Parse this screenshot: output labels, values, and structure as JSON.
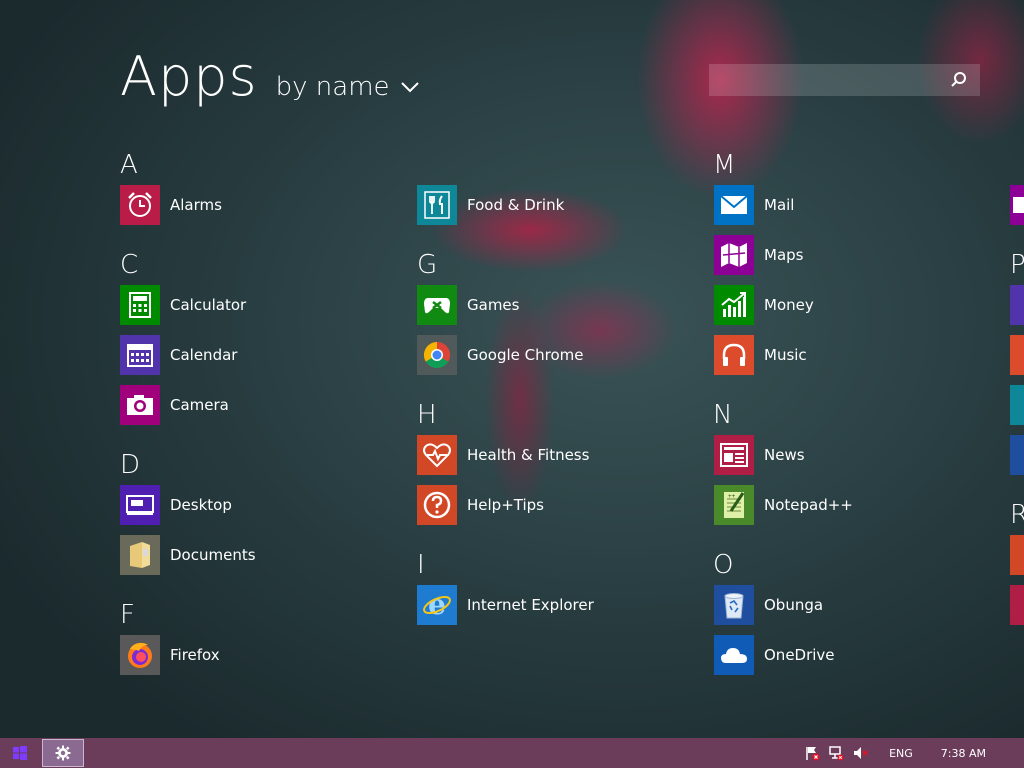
{
  "header": {
    "title": "Apps",
    "sort_label": "by name"
  },
  "search": {
    "value": "",
    "placeholder": ""
  },
  "groups": {
    "a": {
      "letter": "A"
    },
    "c": {
      "letter": "C"
    },
    "d": {
      "letter": "D"
    },
    "f": {
      "letter": "F"
    },
    "g": {
      "letter": "G"
    },
    "h": {
      "letter": "H"
    },
    "i": {
      "letter": "I"
    },
    "m": {
      "letter": "M"
    },
    "n": {
      "letter": "N"
    },
    "o": {
      "letter": "O"
    },
    "p": {
      "letter": "P"
    },
    "r": {
      "letter": "R"
    }
  },
  "apps": {
    "alarms": {
      "label": "Alarms",
      "icon": "alarm-clock-icon",
      "color": "#b91d47"
    },
    "calculator": {
      "label": "Calculator",
      "icon": "calculator-icon",
      "color": "#008a00"
    },
    "calendar": {
      "label": "Calendar",
      "icon": "calendar-icon",
      "color": "#5133ab"
    },
    "camera": {
      "label": "Camera",
      "icon": "camera-icon",
      "color": "#a0007c"
    },
    "desktop": {
      "label": "Desktop",
      "icon": "desktop-icon",
      "color": "#4e1fb1"
    },
    "documents": {
      "label": "Documents",
      "icon": "folder-icon",
      "color": "#6a6a5a"
    },
    "firefox": {
      "label": "Firefox",
      "icon": "firefox-icon",
      "color": "#595959"
    },
    "food": {
      "label": "Food & Drink",
      "icon": "fork-knife-icon",
      "color": "#0e8798"
    },
    "games": {
      "label": "Games",
      "icon": "gamepad-icon",
      "color": "#108a10"
    },
    "chrome": {
      "label": "Google Chrome",
      "icon": "chrome-icon",
      "color": "#505a5a"
    },
    "health": {
      "label": "Health & Fitness",
      "icon": "heart-pulse-icon",
      "color": "#d24726"
    },
    "help": {
      "label": "Help+Tips",
      "icon": "question-icon",
      "color": "#d24726"
    },
    "ie": {
      "label": "Internet Explorer",
      "icon": "internet-explorer-icon",
      "color": "#1e7bd0"
    },
    "mail": {
      "label": "Mail",
      "icon": "envelope-icon",
      "color": "#0072c6"
    },
    "maps": {
      "label": "Maps",
      "icon": "map-icon",
      "color": "#8c0095"
    },
    "money": {
      "label": "Money",
      "icon": "chart-up-icon",
      "color": "#008a00"
    },
    "music": {
      "label": "Music",
      "icon": "headphones-icon",
      "color": "#dc4b2c"
    },
    "news": {
      "label": "News",
      "icon": "newspaper-icon",
      "color": "#b01e45"
    },
    "notepadpp": {
      "label": "Notepad++",
      "icon": "notepad-plus-icon",
      "color": "#4a8a2a"
    },
    "obunga": {
      "label": "Obunga",
      "icon": "recycle-bin-icon",
      "color": "#1f4e9e"
    },
    "onedrive": {
      "label": "OneDrive",
      "icon": "cloud-icon",
      "color": "#0f5bb5"
    }
  },
  "taskbar": {
    "language": "ENG",
    "time": "7:38 AM"
  }
}
